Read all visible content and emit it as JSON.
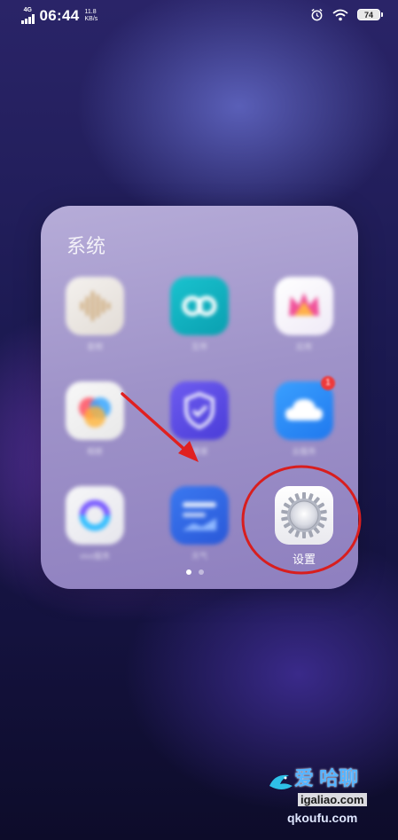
{
  "status_bar": {
    "network_type": "4G",
    "time": "06:44",
    "net_speed_value": "11.8",
    "net_speed_unit": "KB/s",
    "battery_level": "74"
  },
  "folder": {
    "title": "系统",
    "apps": [
      {
        "label": "音频",
        "icon": "sound-wave-icon"
      },
      {
        "label": "互传",
        "icon": "infinity-icon"
      },
      {
        "label": "应用",
        "icon": "crown-icon"
      },
      {
        "label": "相册",
        "icon": "color-circles-icon"
      },
      {
        "label": "i管家",
        "icon": "shield-check-icon"
      },
      {
        "label": "云服务",
        "icon": "cloud-icon",
        "badge": "1"
      },
      {
        "label": "vivo服务",
        "icon": "ring-icon"
      },
      {
        "label": "天气",
        "icon": "weather-icon"
      },
      {
        "label": "设置",
        "icon": "gear-icon"
      }
    ],
    "page_indicator": {
      "pages": 2,
      "current": 1
    }
  },
  "annotation": {
    "arrow_color": "#e02020",
    "circle_color": "#d81e1e"
  },
  "watermark": {
    "line1": "爱 哈聊",
    "line2": "igaliao.com",
    "line3": "qkoufu.com"
  }
}
